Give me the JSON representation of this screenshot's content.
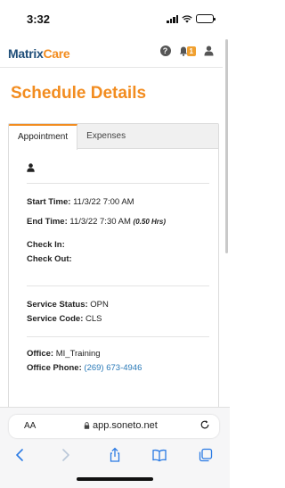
{
  "status_bar": {
    "time": "3:32",
    "battery_level": 0.4
  },
  "app": {
    "logo_prefix": "Matrix",
    "logo_suffix": "Care",
    "notification_count": "1",
    "icons": [
      "help-icon",
      "bell-icon",
      "user-icon"
    ]
  },
  "page": {
    "title": "Schedule Details"
  },
  "tabs": [
    {
      "label": "Appointment",
      "active": true
    },
    {
      "label": "Expenses",
      "active": false
    }
  ],
  "details": {
    "start_label": "Start Time:",
    "start_value": "11/3/22 7:00 AM",
    "end_label": "End Time:",
    "end_value": "11/3/22 7:30 AM",
    "end_duration": "(0.50 Hrs)",
    "check_in_label": "Check In:",
    "check_out_label": "Check Out:",
    "service_status_label": "Service Status:",
    "service_status_value": "OPN",
    "service_code_label": "Service Code:",
    "service_code_value": "CLS",
    "office_label": "Office:",
    "office_value": "MI_Training",
    "office_phone_label": "Office Phone:",
    "office_phone_value": "(269) 673-4946"
  },
  "browser": {
    "text_size_label": "AA",
    "url": "app.soneto.net",
    "icons": [
      "back-icon",
      "forward-icon",
      "share-icon",
      "bookmarks-icon",
      "tabs-icon",
      "reload-icon",
      "lock-icon"
    ]
  }
}
